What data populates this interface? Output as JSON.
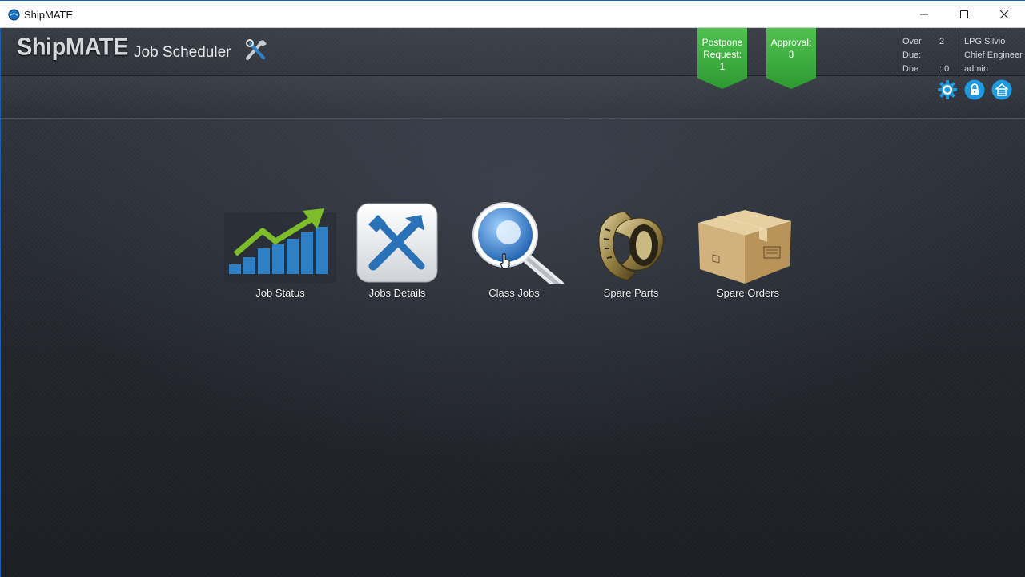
{
  "window": {
    "title": "ShipMATE",
    "controls": [
      "minimize-icon",
      "maximize-icon",
      "close-icon"
    ]
  },
  "header": {
    "brand": "ShipMATE",
    "module": "Job Scheduler",
    "postpone": {
      "line1": "Postpone",
      "line2": "Request:",
      "count": "1"
    },
    "approval": {
      "label": "Approval:",
      "count": "3"
    },
    "due": {
      "overdue_label": "Over Due:",
      "overdue_value": "2",
      "due_label": "Due",
      "due_value": ": 0"
    },
    "user": {
      "vessel": "LPG Silvio",
      "role": "Chief Engineer",
      "name": "admin"
    }
  },
  "toolbar": {
    "icons": [
      "gear-icon",
      "lock-icon",
      "home-icon"
    ]
  },
  "tiles": [
    {
      "label": "Job Status",
      "icon": "bar-chart-icon"
    },
    {
      "label": "Jobs Details",
      "icon": "tools-icon"
    },
    {
      "label": "Class Jobs",
      "icon": "magnifier-icon"
    },
    {
      "label": "Spare Parts",
      "icon": "coupling-icon"
    },
    {
      "label": "Spare Orders",
      "icon": "cardboard-box-icon"
    }
  ],
  "colors": {
    "ribbon_green": "#3aae3d",
    "toolbar_icon_blue": "#1e9be0",
    "chart_blue": "#2f7fc4",
    "chart_arrow_green": "#7dbd2a"
  }
}
